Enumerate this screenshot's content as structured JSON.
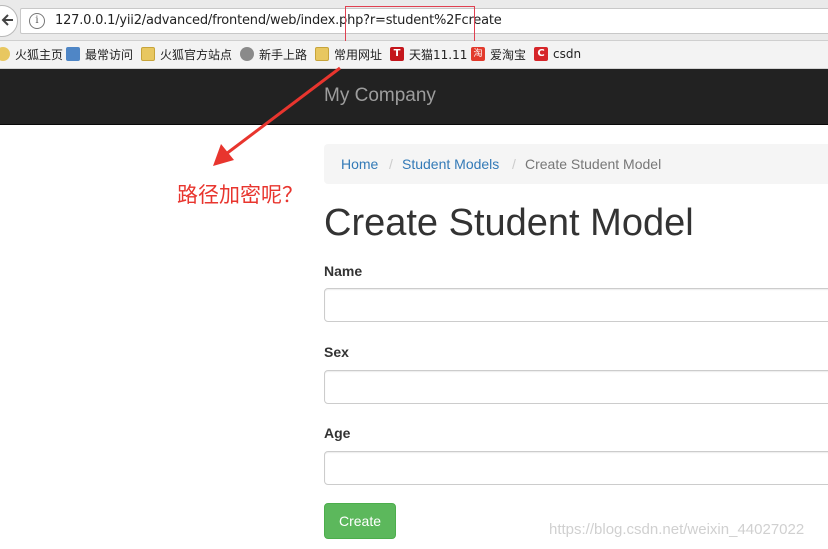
{
  "browser": {
    "url": "127.0.0.1/yii2/advanced/frontend/web/index.php?r=student%2Fcreate",
    "bookmarks": [
      {
        "label": "火狐主页",
        "icon": "firefox-icon"
      },
      {
        "label": "最常访问",
        "icon": "most-visited-icon"
      },
      {
        "label": "火狐官方站点",
        "icon": "folder-icon"
      },
      {
        "label": "新手上路",
        "icon": "globe-icon"
      },
      {
        "label": "常用网址",
        "icon": "folder-icon"
      },
      {
        "label": "天猫11.11",
        "icon": "tmall-icon",
        "glyph": "T"
      },
      {
        "label": "爱淘宝",
        "icon": "taobao-icon",
        "glyph": "淘"
      },
      {
        "label": "csdn",
        "icon": "csdn-icon",
        "glyph": "C"
      }
    ]
  },
  "navbar": {
    "brand": "My Company"
  },
  "breadcrumb": {
    "home": "Home",
    "parent": "Student Models",
    "current": "Create Student Model",
    "separator": "/"
  },
  "page": {
    "title": "Create Student Model"
  },
  "form": {
    "name_label": "Name",
    "sex_label": "Sex",
    "age_label": "Age",
    "submit_label": "Create"
  },
  "annotation": {
    "text": "路径加密呢？",
    "color": "#e8352e"
  },
  "watermark": "https://blog.csdn.net/weixin_44027022",
  "colors": {
    "navbar": "#222222",
    "link": "#337ab7",
    "button": "#5cb85c"
  }
}
